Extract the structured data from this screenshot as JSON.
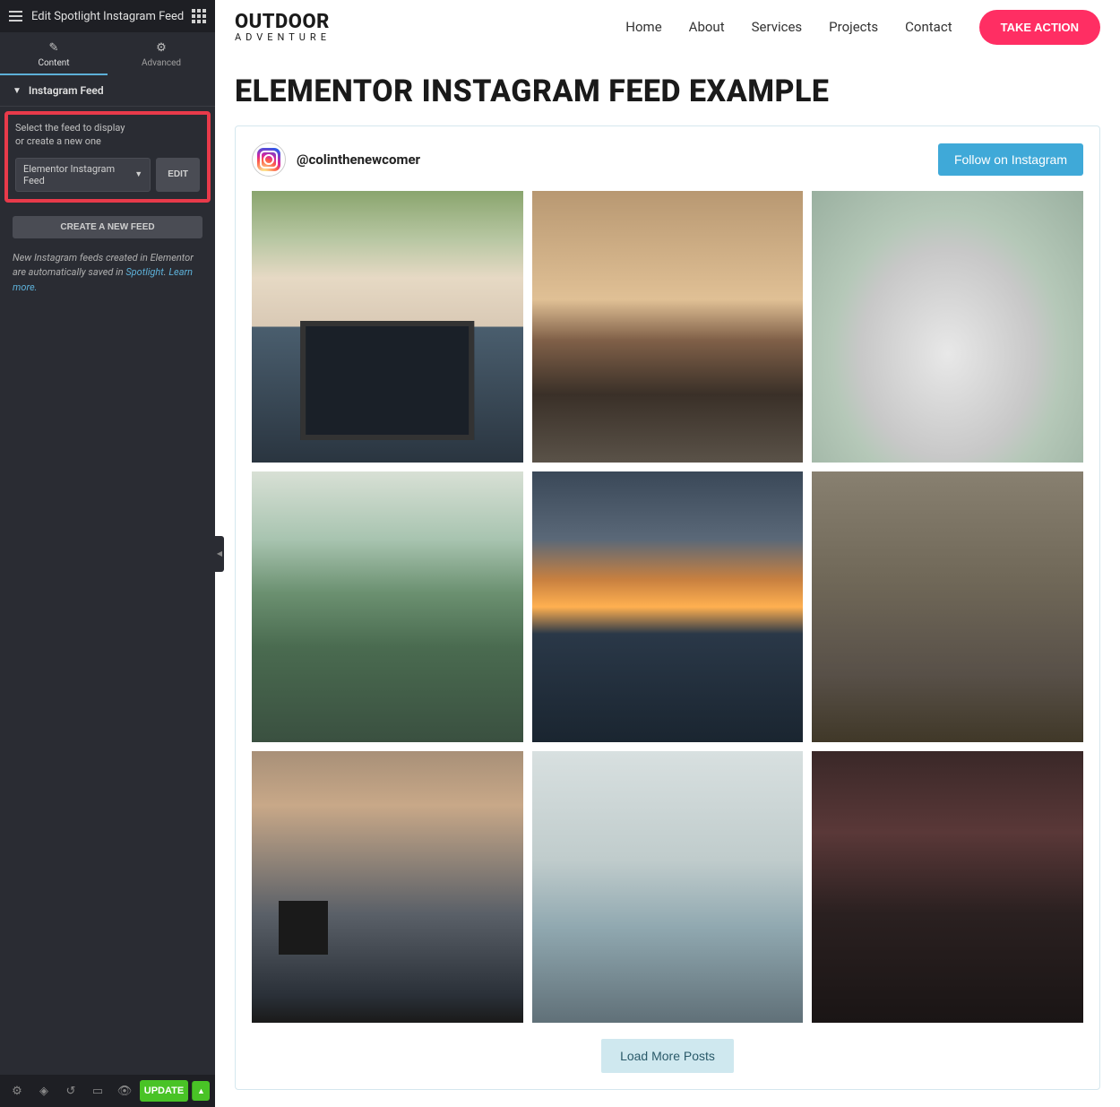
{
  "sidebar": {
    "title": "Edit Spotlight Instagram Feed",
    "tabs": {
      "content": "Content",
      "advanced": "Advanced"
    },
    "section_label": "Instagram Feed",
    "help_text1": "Select the feed to display",
    "help_text2": "or create a new one",
    "dropdown_value": "Elementor Instagram Feed",
    "edit_label": "EDIT",
    "create_label": "CREATE A NEW FEED",
    "info_text1": "New Instagram feeds created in Elementor are automatically saved in ",
    "info_link1": "Spotlight",
    "info_text2": ". ",
    "info_link2": "Learn more.",
    "footer": {
      "update": "UPDATE"
    }
  },
  "site": {
    "brand_top": "OUTDOOR",
    "brand_sub": "ADVENTURE",
    "nav": [
      "Home",
      "About",
      "Services",
      "Projects",
      "Contact"
    ],
    "cta": "TAKE ACTION"
  },
  "page": {
    "title": "ELEMENTOR INSTAGRAM FEED EXAMPLE",
    "username": "@colinthenewcomer",
    "follow": "Follow on Instagram",
    "load_more": "Load More Posts"
  }
}
